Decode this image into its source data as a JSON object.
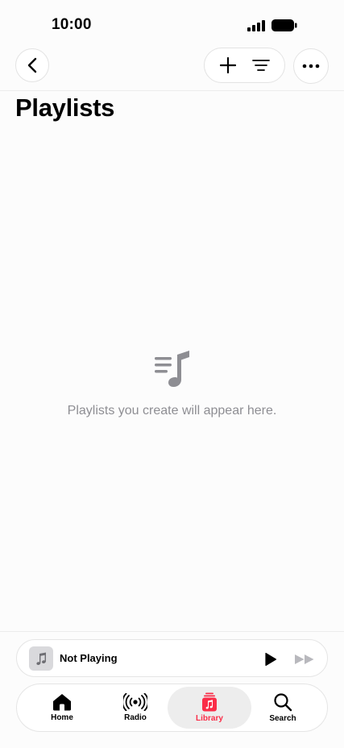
{
  "status": {
    "time": "10:00"
  },
  "nav": {
    "back_icon": "chevron-left-icon",
    "add_icon": "plus-icon",
    "sort_icon": "filter-lines-icon",
    "more_icon": "ellipsis-icon"
  },
  "page": {
    "title": "Playlists"
  },
  "empty": {
    "icon": "playlist-icon",
    "message": "Playlists you create will appear here."
  },
  "mini_player": {
    "title": "Not Playing",
    "artwork_icon": "music-note-icon",
    "play_icon": "play-icon",
    "forward_icon": "fast-forward-icon"
  },
  "tabs": [
    {
      "label": "Home",
      "icon": "home-icon",
      "active": false
    },
    {
      "label": "Radio",
      "icon": "radio-icon",
      "active": false
    },
    {
      "label": "Library",
      "icon": "library-icon",
      "active": true
    },
    {
      "label": "Search",
      "icon": "search-icon",
      "active": false
    }
  ],
  "colors": {
    "accent": "#fa2d48",
    "secondary_text": "#8e8e93",
    "background": "#fcfcfc"
  }
}
